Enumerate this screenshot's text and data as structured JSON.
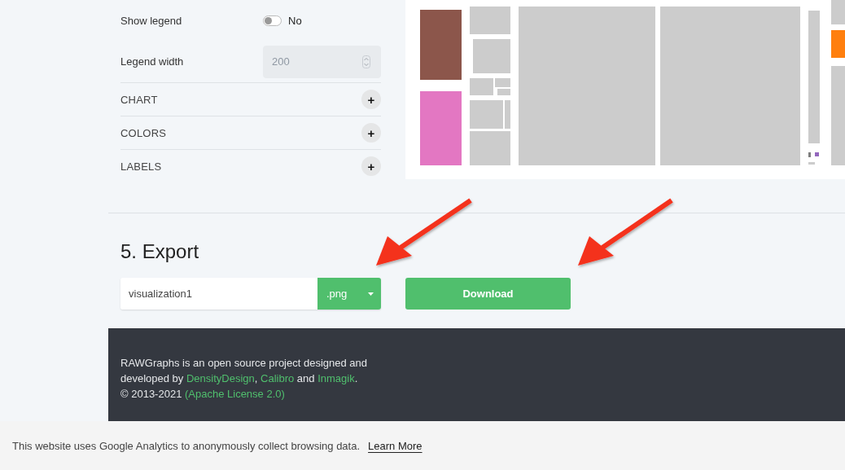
{
  "settings": [
    {
      "kind": "toggle",
      "label": "Show legend",
      "on": false,
      "value": "No"
    },
    {
      "kind": "number",
      "label": "Legend width",
      "value": "200",
      "disabled": true
    }
  ],
  "sections": [
    {
      "label": "CHART",
      "expanded": false,
      "icon": "+"
    },
    {
      "label": "COLORS",
      "expanded": false,
      "icon": "+"
    },
    {
      "label": "LABELS",
      "expanded": false,
      "icon": "+"
    }
  ],
  "export": {
    "heading": "5. Export",
    "filename": "visualization1",
    "format": ".png",
    "button": "Download"
  },
  "footer": {
    "lines": [
      [
        {
          "kind": "text",
          "text": "RAWGraphs is an open source project designed and"
        }
      ],
      [
        {
          "kind": "text",
          "text": "developed by "
        },
        {
          "kind": "link",
          "text": "DensityDesign"
        },
        {
          "kind": "text",
          "text": ", "
        },
        {
          "kind": "link",
          "text": "Calibro"
        },
        {
          "kind": "text",
          "text": " and "
        },
        {
          "kind": "link",
          "text": "Inmagik"
        },
        {
          "kind": "text",
          "text": "."
        }
      ],
      [
        {
          "kind": "text",
          "text": "© 2013-2021 "
        },
        {
          "kind": "link",
          "text": "(Apache License 2.0)"
        }
      ]
    ]
  },
  "cookie_banner": {
    "text": "This website uses Google Analytics to anonymously collect browsing data.",
    "link": "Learn More"
  }
}
